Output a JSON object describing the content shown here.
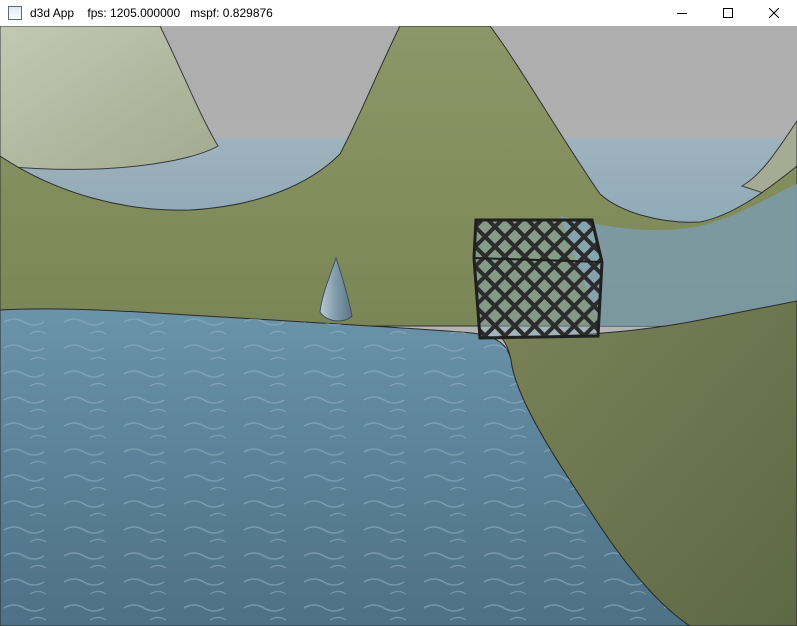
{
  "window": {
    "title": "d3d App    fps: 1205.000000   mspf: 0.829876",
    "icon": "app-window-icon",
    "controls": {
      "minimize": "minimize-icon",
      "maximize": "maximize-icon",
      "close": "close-icon"
    }
  },
  "scene": {
    "sky_color": "#b4b4b4",
    "water_color": "#4f7f98",
    "land_color": "#7e8a5a",
    "objects": [
      "terrain-hills",
      "water-surface",
      "wire-fence-crate",
      "cone-marker"
    ]
  }
}
